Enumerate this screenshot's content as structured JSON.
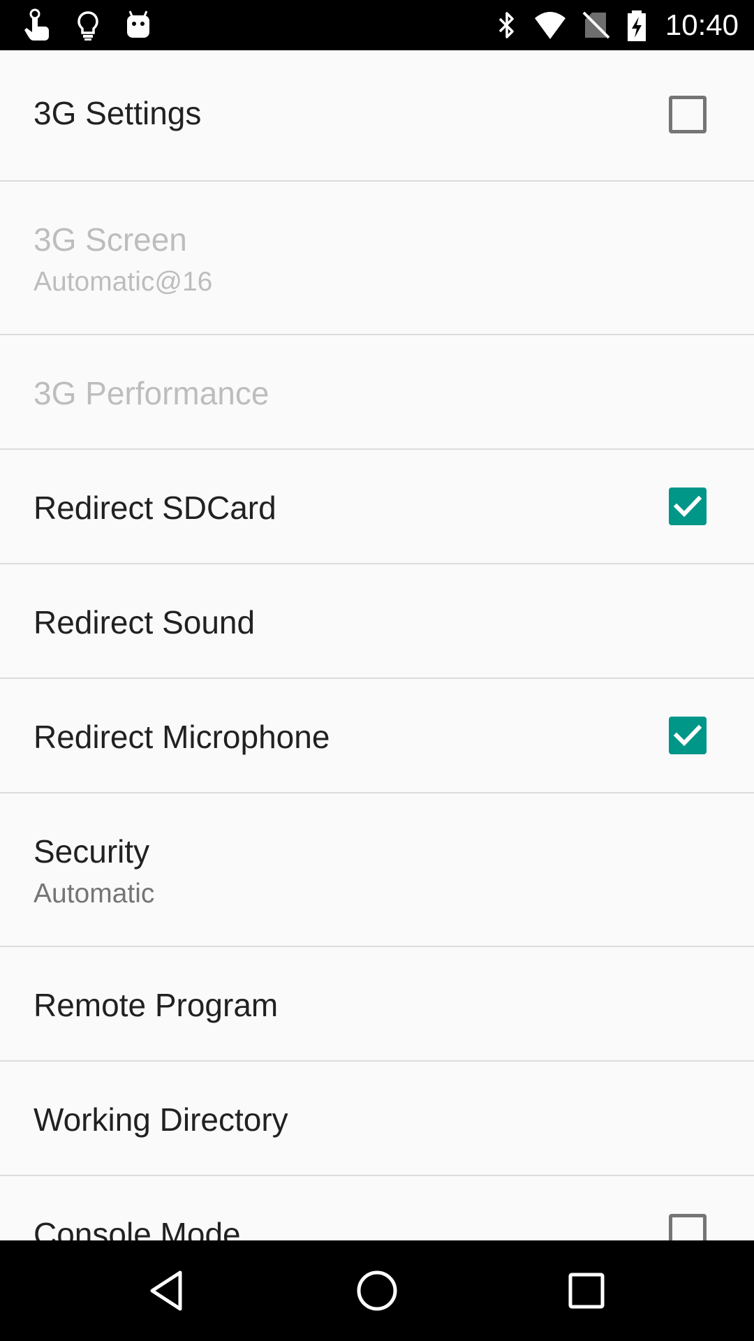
{
  "status_bar": {
    "time": "10:40",
    "left_icons": [
      "touch-icon",
      "lightbulb-icon",
      "android-icon"
    ],
    "right_icons": [
      "bluetooth-icon",
      "wifi-icon",
      "no-sim-icon",
      "battery-charging-icon"
    ]
  },
  "preferences": [
    {
      "title": "3G Settings",
      "summary": "",
      "control": "checkbox",
      "checked": false,
      "enabled": true
    },
    {
      "title": "3G Screen",
      "summary": "Automatic@16",
      "control": "none",
      "enabled": false
    },
    {
      "title": "3G Performance",
      "summary": "",
      "control": "none",
      "enabled": false
    },
    {
      "title": "Redirect SDCard",
      "summary": "",
      "control": "checkbox",
      "checked": true,
      "enabled": true
    },
    {
      "title": "Redirect Sound",
      "summary": "",
      "control": "none",
      "enabled": true
    },
    {
      "title": "Redirect Microphone",
      "summary": "",
      "control": "checkbox",
      "checked": true,
      "enabled": true
    },
    {
      "title": "Security",
      "summary": "Automatic",
      "control": "none",
      "enabled": true
    },
    {
      "title": "Remote Program",
      "summary": "",
      "control": "none",
      "enabled": true
    },
    {
      "title": "Working Directory",
      "summary": "",
      "control": "none",
      "enabled": true
    },
    {
      "title": "Console Mode",
      "summary": "",
      "control": "checkbox",
      "checked": false,
      "enabled": true
    }
  ],
  "nav_bar": {
    "buttons": [
      "back-icon",
      "home-icon",
      "recents-icon"
    ]
  },
  "colors": {
    "accent": "#009688",
    "background": "#fafafa",
    "divider": "#dcdcdc",
    "text_primary": "#212121",
    "text_secondary": "#757575",
    "text_disabled": "#bdbdbd"
  }
}
